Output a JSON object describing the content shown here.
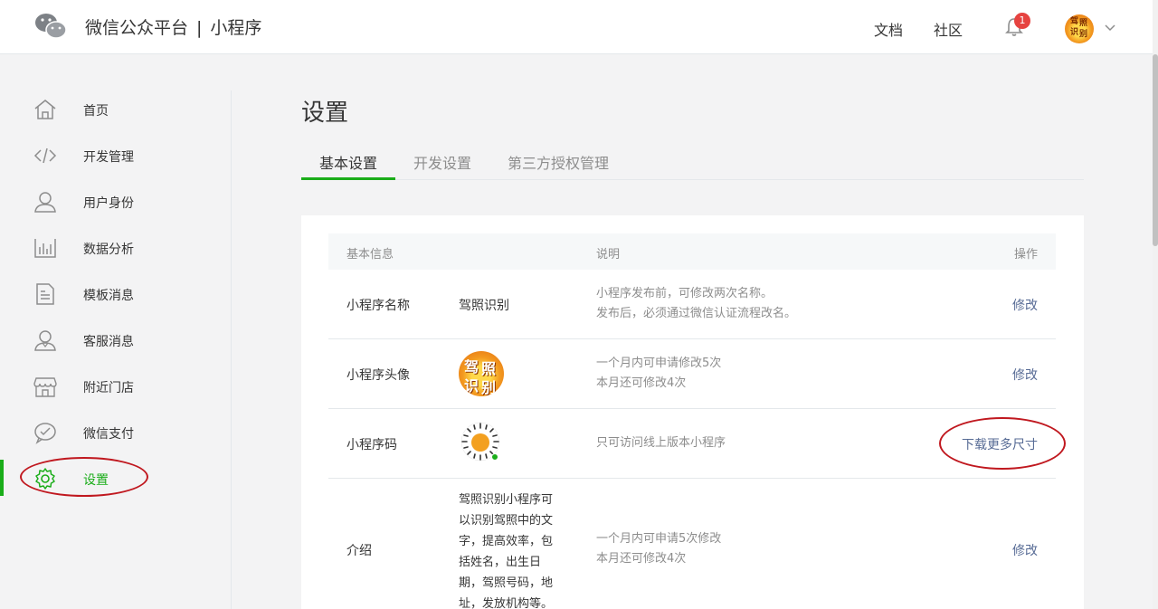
{
  "header": {
    "brand_main": "微信公众平台",
    "brand_sep": "|",
    "brand_sub": "小程序",
    "nav_docs": "文档",
    "nav_community": "社区",
    "notification_count": "1",
    "avatar_chars": [
      "驾",
      "照",
      "识",
      "别"
    ]
  },
  "sidebar": {
    "items": [
      {
        "label": "首页",
        "icon": "home-icon"
      },
      {
        "label": "开发管理",
        "icon": "code-icon"
      },
      {
        "label": "用户身份",
        "icon": "user-icon"
      },
      {
        "label": "数据分析",
        "icon": "chart-icon"
      },
      {
        "label": "模板消息",
        "icon": "document-icon"
      },
      {
        "label": "客服消息",
        "icon": "customer-service-icon"
      },
      {
        "label": "附近门店",
        "icon": "store-icon"
      },
      {
        "label": "微信支付",
        "icon": "wechat-pay-icon"
      },
      {
        "label": "设置",
        "icon": "gear-icon",
        "active": true
      }
    ]
  },
  "main": {
    "title": "设置",
    "tabs": [
      {
        "label": "基本设置",
        "active": true
      },
      {
        "label": "开发设置"
      },
      {
        "label": "第三方授权管理"
      }
    ],
    "table": {
      "headers": {
        "info": "基本信息",
        "desc": "说明",
        "action": "操作"
      },
      "rows": [
        {
          "label": "小程序名称",
          "value": "驾照识别",
          "desc_line1": "小程序发布前，可修改两次名称。",
          "desc_line2": "发布后，必须通过微信认证流程改名。",
          "action": "修改"
        },
        {
          "label": "小程序头像",
          "avatar_chars": [
            "驾",
            "照",
            "识",
            "别"
          ],
          "desc_line1": "一个月内可申请修改5次",
          "desc_line2": "本月还可修改4次",
          "action": "修改"
        },
        {
          "label": "小程序码",
          "desc_line1": "只可访问线上版本小程序",
          "action": "下载更多尺寸"
        },
        {
          "label": "介绍",
          "intro_lines": [
            "驾照识别小程序可",
            "以识别驾照中的文",
            "字，提高效率，包",
            "括姓名，出生日",
            "期，驾照号码，地",
            "址，发放机构等。"
          ],
          "desc_line1": "一个月内可申请5次修改",
          "desc_line2": "本月还可修改4次",
          "action": "修改"
        }
      ]
    }
  },
  "colors": {
    "accent_green": "#1aad19",
    "link_blue": "#576b95",
    "annotation_red": "#c0181f",
    "badge_red": "#e64340"
  }
}
